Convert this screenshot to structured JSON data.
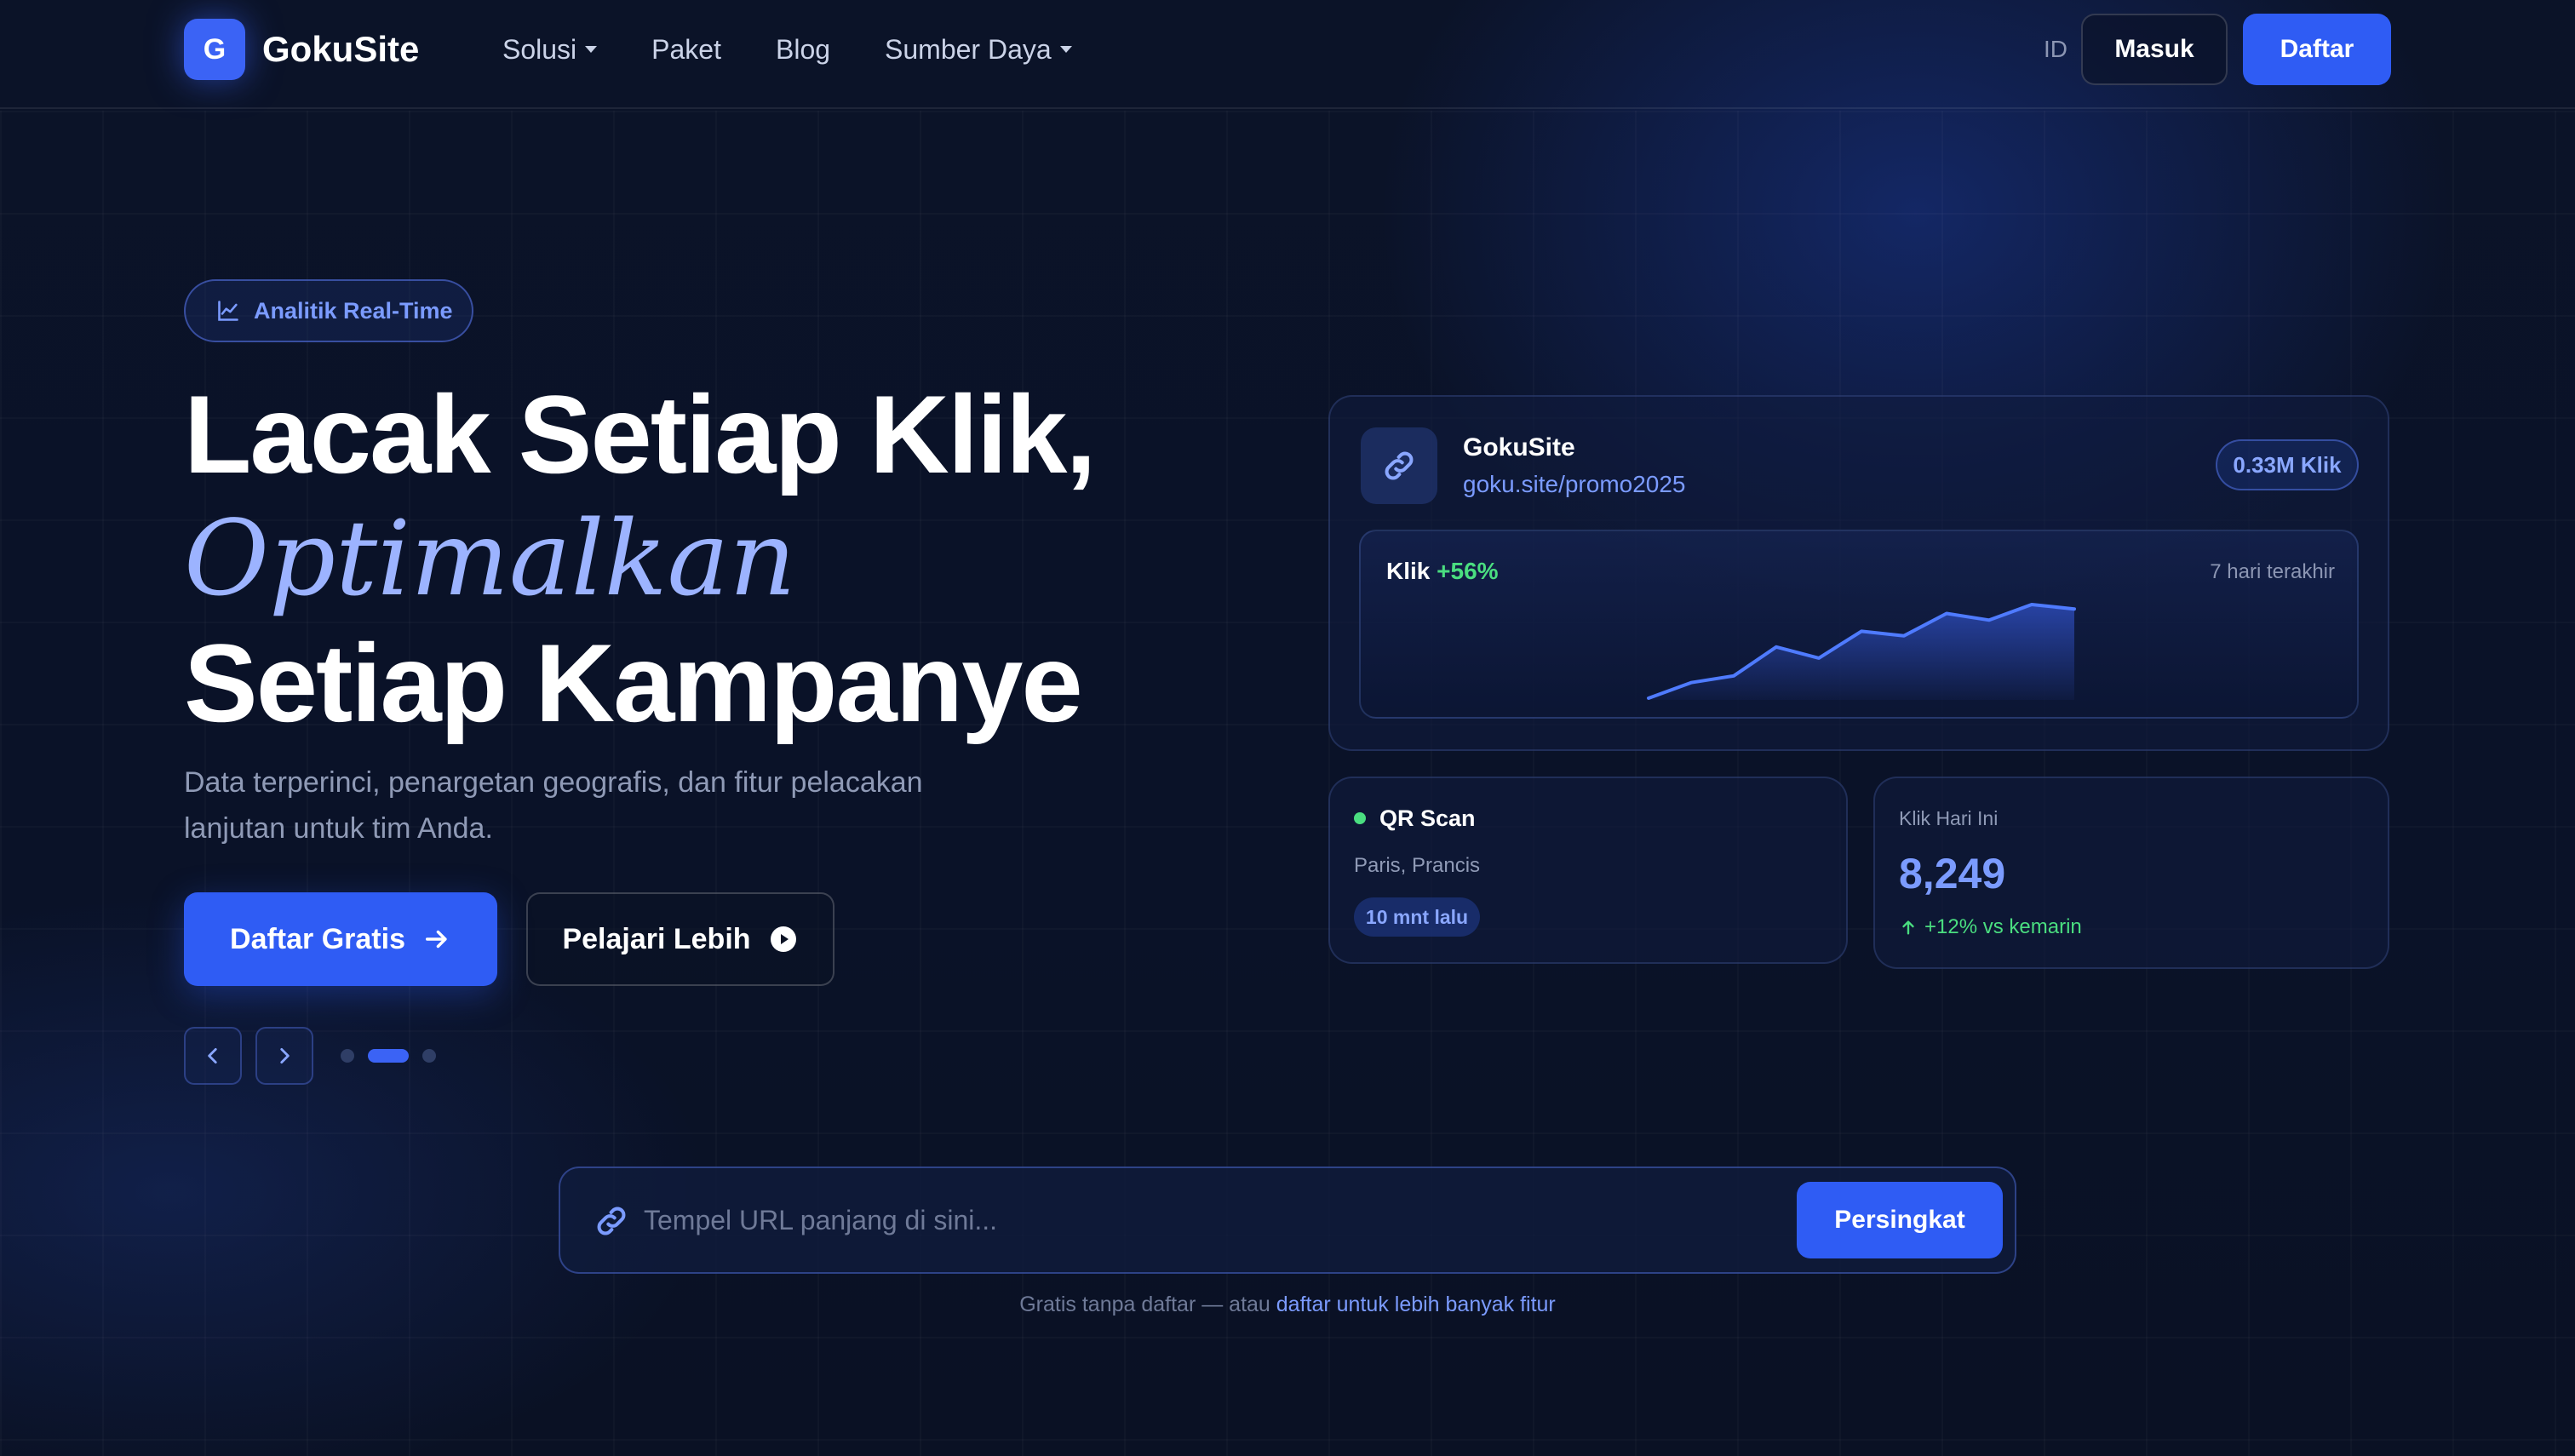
{
  "nav": {
    "logo_letter": "G",
    "brand": "GokuSite",
    "links": [
      {
        "label": "Solusi",
        "dropdown": true
      },
      {
        "label": "Paket",
        "dropdown": false
      },
      {
        "label": "Blog",
        "dropdown": false
      },
      {
        "label": "Sumber Daya",
        "dropdown": true
      }
    ],
    "lang": "ID",
    "login": "Masuk",
    "signup": "Daftar"
  },
  "hero": {
    "badge": "Analitik Real-Time",
    "line1": "Lacak Setiap Klik,",
    "line2": "Optimalkan",
    "line3": "Setiap Kampanye",
    "subtitle": "Data terperinci, penargetan geografis, dan fitur pelacakan lanjutan untuk tim Anda.",
    "cta_primary": "Daftar Gratis",
    "cta_secondary": "Pelajari Lebih",
    "slides": {
      "count": 3,
      "active": 1
    }
  },
  "link_card": {
    "title": "GokuSite",
    "url": "goku.site/promo2025",
    "badge": "0.33M Klik",
    "chart_label": "Klik",
    "chart_change": "+56%",
    "chart_range": "7 hari terakhir"
  },
  "chart_data": {
    "type": "area",
    "values": [
      0,
      7,
      10,
      23,
      18,
      30,
      28,
      38,
      35,
      42,
      40
    ]
  },
  "qr_card": {
    "title": "QR Scan",
    "location": "Paris, Prancis",
    "time": "10 mnt lalu"
  },
  "today_card": {
    "label": "Klik Hari Ini",
    "value": "8,249",
    "delta": "+12% vs kemarin"
  },
  "shortener": {
    "placeholder": "Tempel URL panjang di sini...",
    "button": "Persingkat",
    "footer_text": "Gratis tanpa daftar — atau ",
    "footer_link": "daftar untuk lebih banyak fitur"
  },
  "colors": {
    "accent": "#2f5cf4",
    "accent_text": "#7b9bff",
    "positive": "#4ade80",
    "background": "#0a1124"
  }
}
